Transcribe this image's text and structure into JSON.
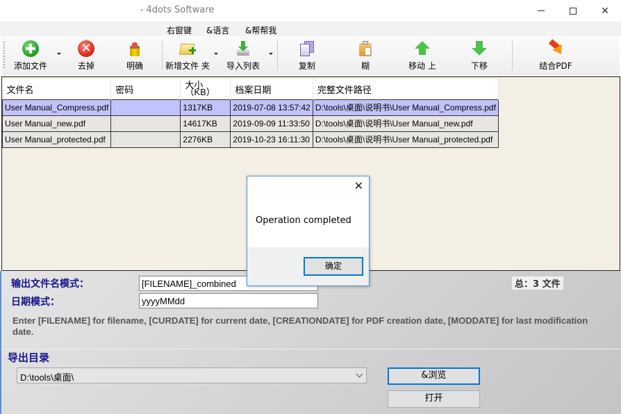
{
  "window": {
    "title": "- 4dots Software",
    "min_icon": "minimize-icon",
    "max_icon": "maximize-icon",
    "close_icon": "close-icon"
  },
  "menu": [
    {
      "label": "右窗键"
    },
    {
      "label": "&语言"
    },
    {
      "label": "&帮帮我"
    }
  ],
  "toolbar": {
    "add_files": {
      "label": "添加文件",
      "icon": "add-circle-icon"
    },
    "remove": {
      "label": "去掉",
      "icon": "remove-circle-icon"
    },
    "clear": {
      "label": "明确",
      "icon": "brush-icon"
    },
    "add_folder": {
      "label": "新增文件 夹",
      "icon": "folder-add-icon"
    },
    "import_list": {
      "label": "导入列表",
      "icon": "import-icon"
    },
    "copy": {
      "label": "复制",
      "icon": "copy-icon"
    },
    "paste": {
      "label": "糊",
      "icon": "paste-icon"
    },
    "move_up": {
      "label": "移动 上",
      "icon": "arrow-up-icon"
    },
    "move_down": {
      "label": "下移",
      "icon": "arrow-down-icon"
    },
    "combine": {
      "label": "结合PDF",
      "icon": "combine-pdf-icon"
    }
  },
  "table": {
    "headers": [
      "文件名",
      "密码",
      "大小（KB）",
      "档案日期",
      "完整文件路径"
    ],
    "rows": [
      {
        "name": "User Manual_Compress.pdf",
        "password": "",
        "size": "1317KB",
        "date": "2019-07-08 13:57:42",
        "path": "D:\\tools\\桌面\\说明书\\User Manual_Compress.pdf",
        "selected": true
      },
      {
        "name": "User Manual_new.pdf",
        "password": "",
        "size": "14617KB",
        "date": "2019-09-09 11:33:50",
        "path": "D:\\tools\\桌面\\说明书\\User Manual_new.pdf",
        "selected": false
      },
      {
        "name": "User Manual_protected.pdf",
        "password": "",
        "size": "2276KB",
        "date": "2019-10-23 16:11:30",
        "path": "D:\\tools\\桌面\\说明书\\User Manual_protected.pdf",
        "selected": false
      }
    ]
  },
  "output": {
    "filename_pattern_label": "输出文件名模式：",
    "filename_pattern_value": "[FILENAME]_combined",
    "date_pattern_label": "日期模式：",
    "date_pattern_value": "yyyyMMdd",
    "hint": "Enter [FILENAME] for filename, [CURDATE] for current date, [CREATIONDATE] for PDF creation date, [MODDATE] for last modification date.",
    "total": "总：3 文件",
    "folder_label": "导出目录",
    "folder_value": "D:\\tools\\桌面\\",
    "browse_label": "&浏览",
    "open_label": "打开"
  },
  "dialog": {
    "message": "Operation completed",
    "ok_label": "确定"
  },
  "colors": {
    "selected_row": "#c3c3fb",
    "accent": "#0078d7",
    "label_blue": "#14148c"
  }
}
